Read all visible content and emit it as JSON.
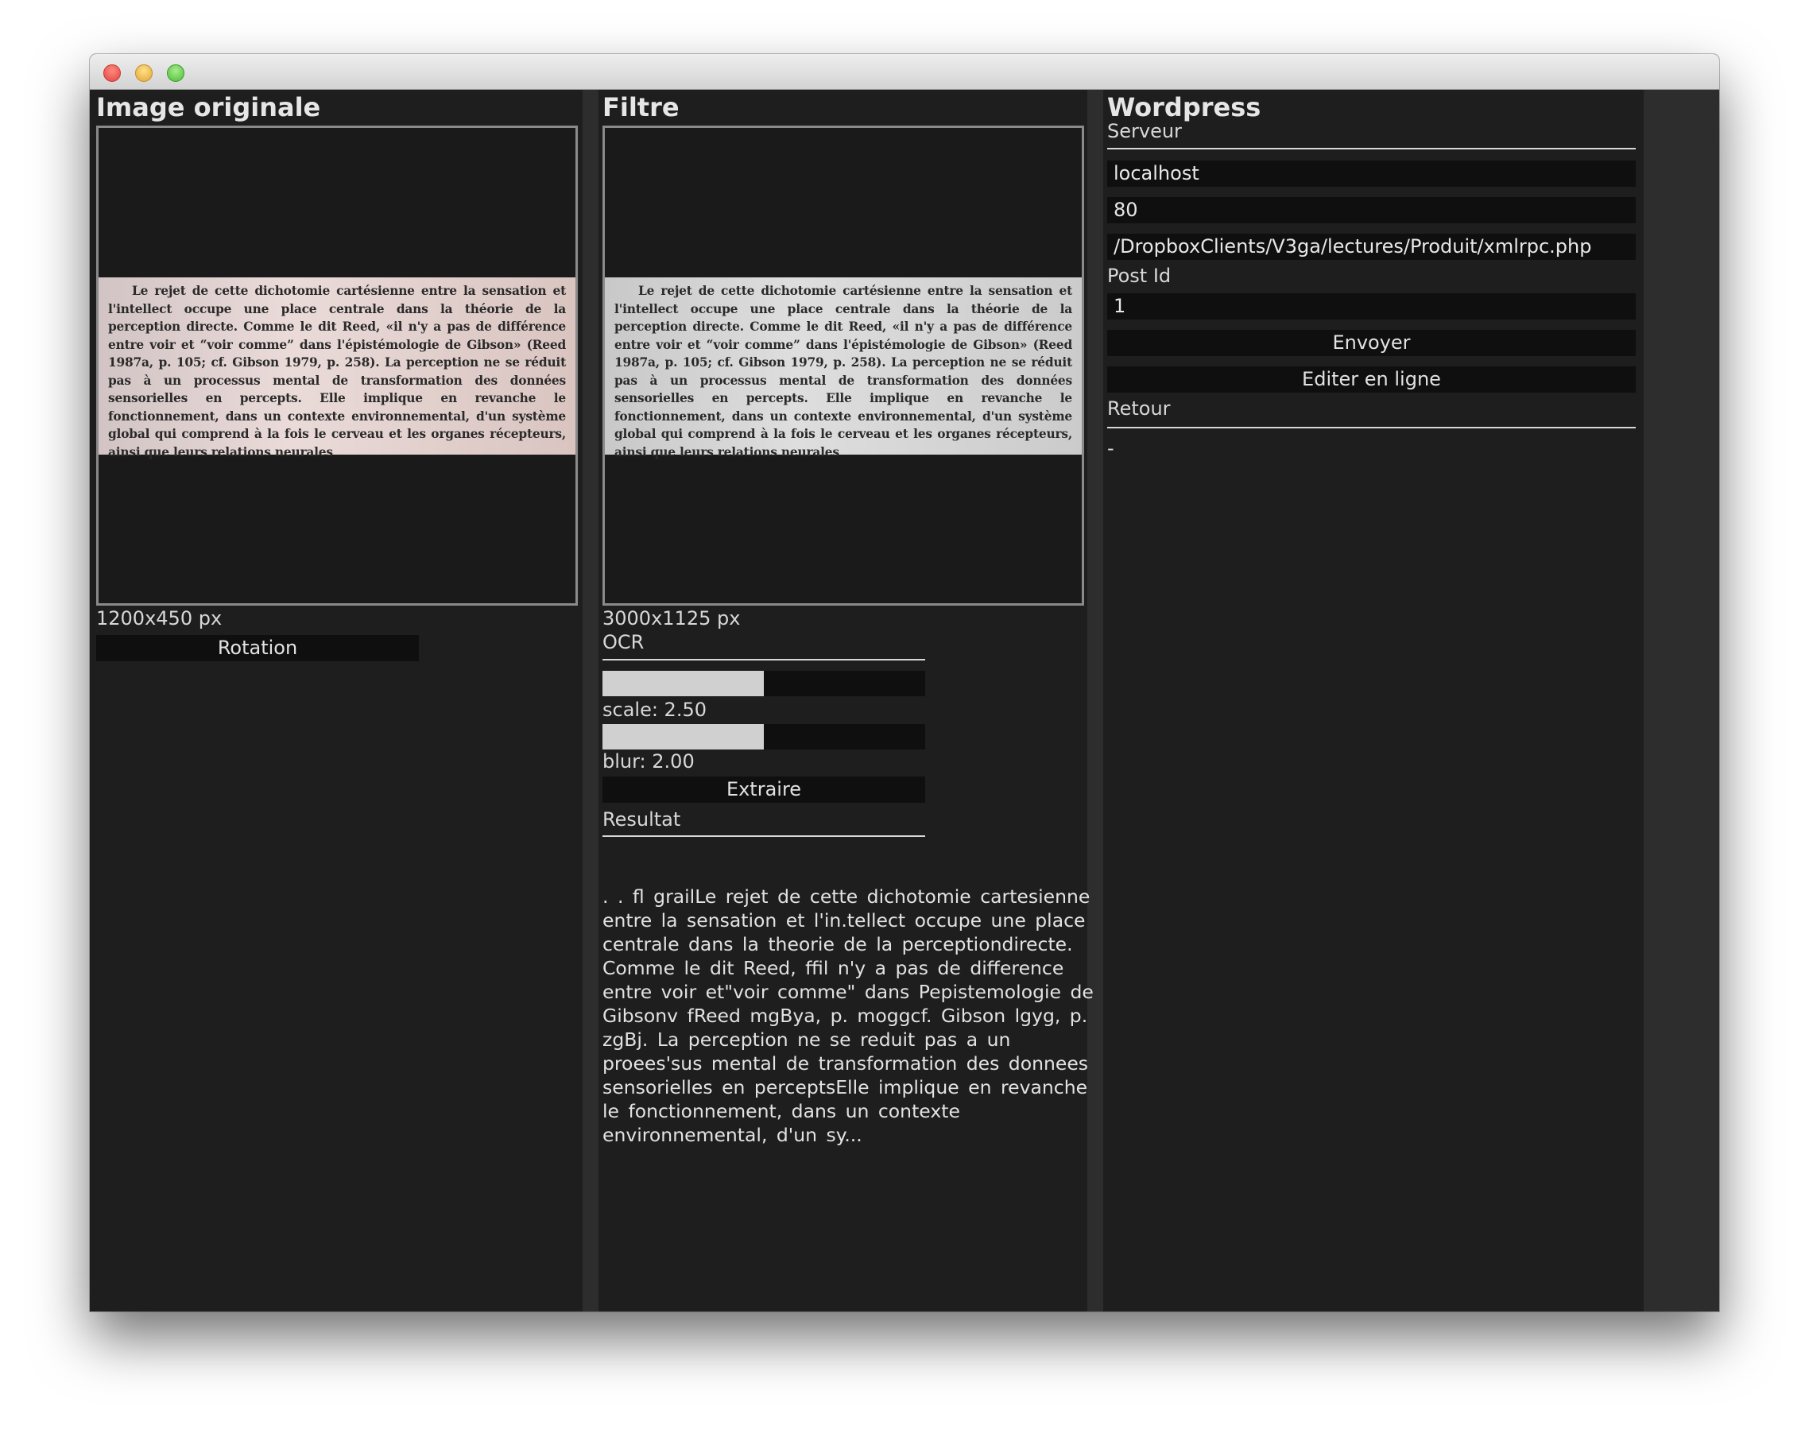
{
  "colors": {
    "background": "#1e1e1e",
    "divider": "#2d2d2d",
    "button": "#0f0f0f",
    "text": "#e2e2e2"
  },
  "titlebar_icons": [
    "close-button",
    "minimize-button",
    "zoom-button"
  ],
  "left": {
    "title": "Image  originale",
    "size_label": "1200x450  px",
    "rotation_button": "Rotation"
  },
  "middle": {
    "title": "Filtre",
    "size_label": "3000x1125  px",
    "ocr_label": "OCR",
    "scale_label": "scale:  2.50",
    "blur_label": "blur:  2.00",
    "scale_fill_fraction": 0.5,
    "blur_fill_fraction": 0.5,
    "extract_button": "Extraire",
    "result_label": "Resultat",
    "result_text": ". .  fl  grailLe  rejet  de  cette  dichotomie  cartesienne  entre  la  sensation  et  l'in.tellect  occupe  une  place  centrale  dans  la  theorie  de  la  perceptiondirecte.  Comme  le  dit  Reed,  ffil  n'y  a  pas  de  difference  entre  voir  et\"voir  comme\"  dans  Pepistemologie  de  Gibsonv  fReed  mgBya,  p.  moggcf.  Gibson  lgyg,  p.  zgBj.  La  perception  ne  se  reduit  pas  a  un  proees'sus  mental  de  transformation  des  donnees  sensorielles  en  perceptsElle  implique  en  revanche  le  fonctionnement,  dans  un  contexte  environnemental,  d'un  sy..."
  },
  "document_text": "Le rejet de cette dichotomie cartésienne entre la sensation et l'intellect occupe une place centrale dans la théorie de la perception directe. Comme le dit Reed, «il n'y a pas de différence entre voir et “voir comme” dans l'épistémologie de Gibson» (Reed 1987a, p. 105; cf. Gibson 1979, p. 258). La perception ne se réduit pas à un processus mental de transformation des données sensorielles en percepts. Elle implique en revanche le fonctionnement, dans un contexte environnemental, d'un système global qui comprend à la fois le cerveau et les organes récepteurs, ainsi que leurs relations neurales",
  "wordpress": {
    "title": "Wordpress",
    "server_label": "Serveur",
    "host": "localhost",
    "port": "80",
    "path": "/DropboxClients/V3ga/lectures/Produit/xmlrpc.php",
    "post_id_label": "Post  Id",
    "post_id": "1",
    "send_button": "Envoyer",
    "edit_button": "Editer  en  ligne",
    "return_label": "Retour",
    "return_value": "-"
  }
}
